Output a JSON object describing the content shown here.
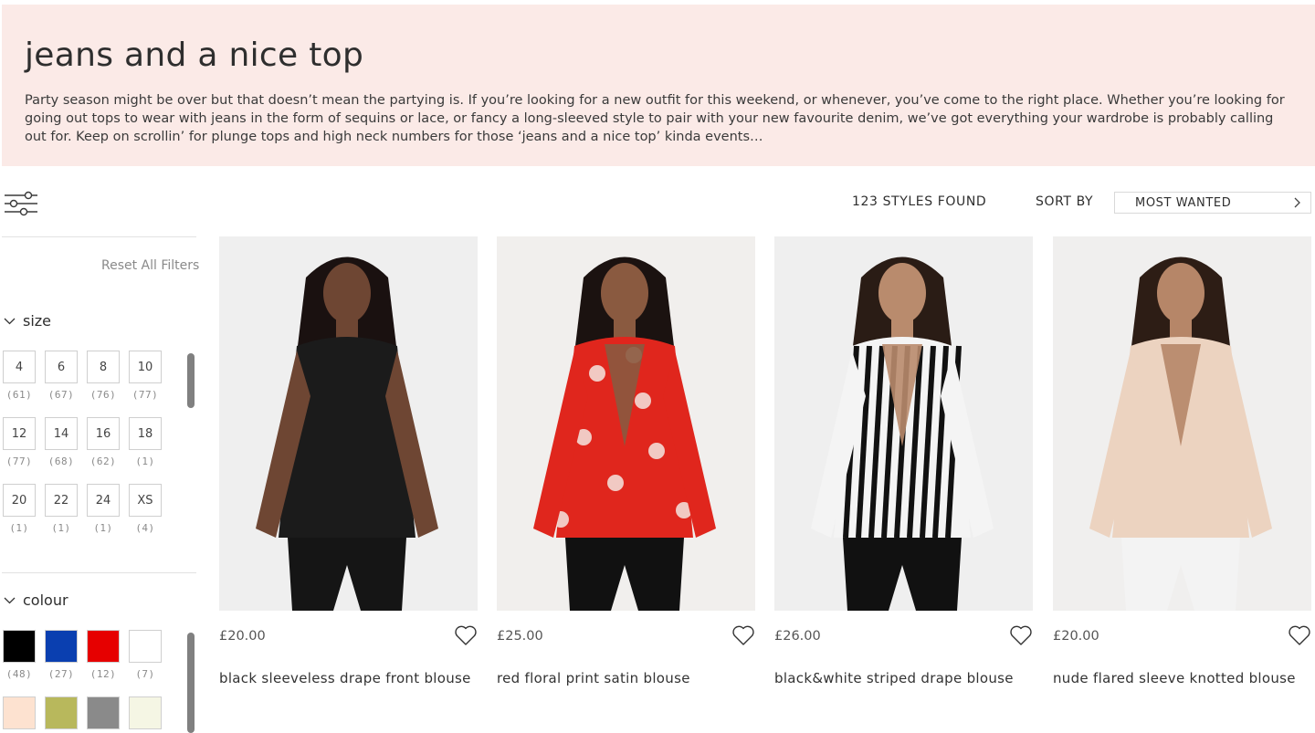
{
  "banner": {
    "title": "jeans and a nice top",
    "description": "Party season might be over but that doesn’t mean the partying is. If you’re looking for a new outfit for this weekend, or whenever, you’ve come to the right place. Whether you’re looking for going out tops to wear with jeans in the form of sequins or lace, or fancy a long-sleeved style to pair with your new favourite denim, we’ve got everything your wardrobe is probably calling out for. Keep on scrollin’ for plunge tops and high neck numbers for those ‘jeans and a nice top’ kinda events…"
  },
  "toolbar": {
    "filter_icon": "sliders-icon",
    "styles_found": "123 STYLES FOUND",
    "sort_label": "SORT BY",
    "sort_value": "MOST WANTED"
  },
  "filters": {
    "reset_label": "Reset All Filters",
    "size": {
      "title": "size",
      "options": [
        {
          "label": "4",
          "count": "(61)"
        },
        {
          "label": "6",
          "count": "(67)"
        },
        {
          "label": "8",
          "count": "(76)"
        },
        {
          "label": "10",
          "count": "(77)"
        },
        {
          "label": "12",
          "count": "(77)"
        },
        {
          "label": "14",
          "count": "(68)"
        },
        {
          "label": "16",
          "count": "(62)"
        },
        {
          "label": "18",
          "count": "(1)"
        },
        {
          "label": "20",
          "count": "(1)"
        },
        {
          "label": "22",
          "count": "(1)"
        },
        {
          "label": "24",
          "count": "(1)"
        },
        {
          "label": "XS",
          "count": "(4)"
        }
      ]
    },
    "colour": {
      "title": "colour",
      "options": [
        {
          "color": "#000000",
          "count": "(48)"
        },
        {
          "color": "#0a3fb0",
          "count": "(27)"
        },
        {
          "color": "#e60000",
          "count": "(12)"
        },
        {
          "color": "#ffffff",
          "count": "(7)"
        },
        {
          "color": "#fde2d0",
          "count": ""
        },
        {
          "color": "#b8b85c",
          "count": ""
        },
        {
          "color": "#8a8a8a",
          "count": ""
        },
        {
          "color": "#f5f6e4",
          "count": ""
        }
      ]
    }
  },
  "products": [
    {
      "price": "£20.00",
      "name": "black sleeveless drape front blouse",
      "top_color": "#1b1b1b",
      "bottom_color": "#151515",
      "skin": "#6e4633",
      "hair": "#1a1110",
      "bg": "#efefef"
    },
    {
      "price": "£25.00",
      "name": "red floral print satin blouse",
      "top_color": "#e0261d",
      "bottom_color": "#111111",
      "skin": "#8a5a40",
      "hair": "#1b1210",
      "bg": "#f1efed"
    },
    {
      "price": "£26.00",
      "name": "black&white striped drape blouse",
      "top_color": "#f4f4f4",
      "bottom_color": "#111111",
      "skin": "#b98b6d",
      "hair": "#2a1c15",
      "bg": "#efefef"
    },
    {
      "price": "£20.00",
      "name": "nude flared sleeve knotted blouse",
      "top_color": "#ecd3c0",
      "bottom_color": "#f3f3f3",
      "skin": "#b68668",
      "hair": "#2d1d15",
      "bg": "#f0efee"
    }
  ]
}
